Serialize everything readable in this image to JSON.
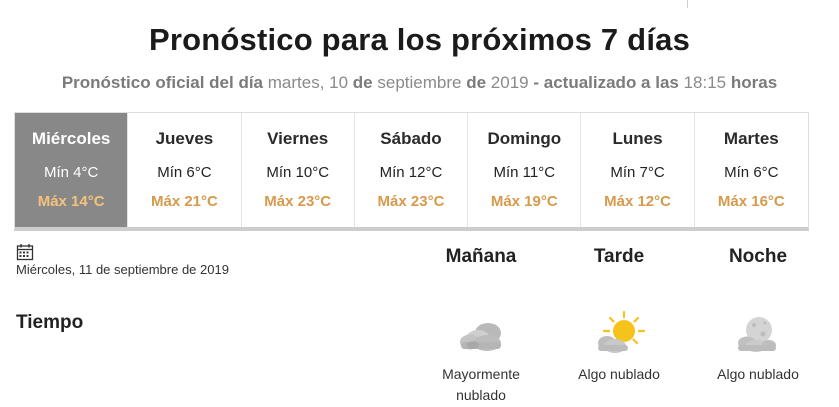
{
  "title": "Pronóstico para los próximos 7 días",
  "subtitle": {
    "label_official": "Pronóstico oficial del día",
    "weekday": "martes, 10",
    "de1": "de",
    "month": "septiembre",
    "de2": "de",
    "year": "2019",
    "label_updated": "- actualizado a las",
    "time": "18:15",
    "label_hours": "horas"
  },
  "days": [
    {
      "name": "Miércoles",
      "min": "Mín 4°C",
      "max": "Máx 14°C"
    },
    {
      "name": "Jueves",
      "min": "Mín 6°C",
      "max": "Máx 21°C"
    },
    {
      "name": "Viernes",
      "min": "Mín 10°C",
      "max": "Máx 23°C"
    },
    {
      "name": "Sábado",
      "min": "Mín 12°C",
      "max": "Máx 23°C"
    },
    {
      "name": "Domingo",
      "min": "Mín 11°C",
      "max": "Máx 19°C"
    },
    {
      "name": "Lunes",
      "min": "Mín 7°C",
      "max": "Máx 12°C"
    },
    {
      "name": "Martes",
      "min": "Mín 6°C",
      "max": "Máx 16°C"
    }
  ],
  "selected_date": "Miércoles, 11 de septiembre de 2019",
  "periods": {
    "manana": "Mañana",
    "tarde": "Tarde",
    "noche": "Noche"
  },
  "tiempo_label": "Tiempo",
  "conditions": {
    "manana": {
      "text": "Mayormente nublado",
      "icon": "mostly-cloudy-icon"
    },
    "tarde": {
      "text": "Algo nublado",
      "icon": "partly-cloudy-day-icon"
    },
    "noche": {
      "text": "Algo nublado",
      "icon": "partly-cloudy-night-icon"
    }
  },
  "colors": {
    "active_tab": "#888888",
    "max_temp": "#d79a4b",
    "sun": "#f6c21c"
  }
}
